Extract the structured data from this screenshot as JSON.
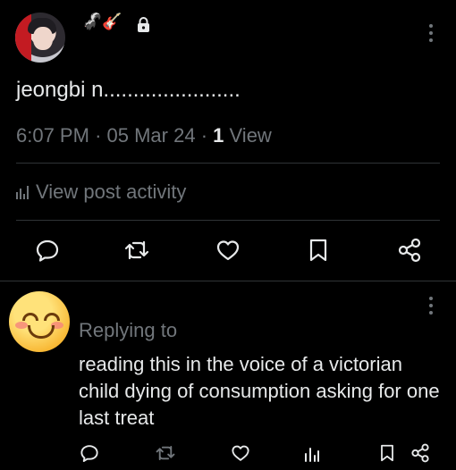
{
  "post": {
    "author_badges": "🦨🎸",
    "text": "jeongbi n.......................",
    "time": "6:07 PM",
    "date": "05 Mar 24",
    "views_count": "1",
    "views_label": "View",
    "activity_label": "View post activity"
  },
  "reply": {
    "replying_label": "Replying to",
    "text": "reading this in the voice of a victorian child dying of consumption asking for one last treat"
  },
  "colors": {
    "background": "#000000",
    "text": "#e7e9ea",
    "muted": "#71767b",
    "divider": "#2f3336"
  }
}
